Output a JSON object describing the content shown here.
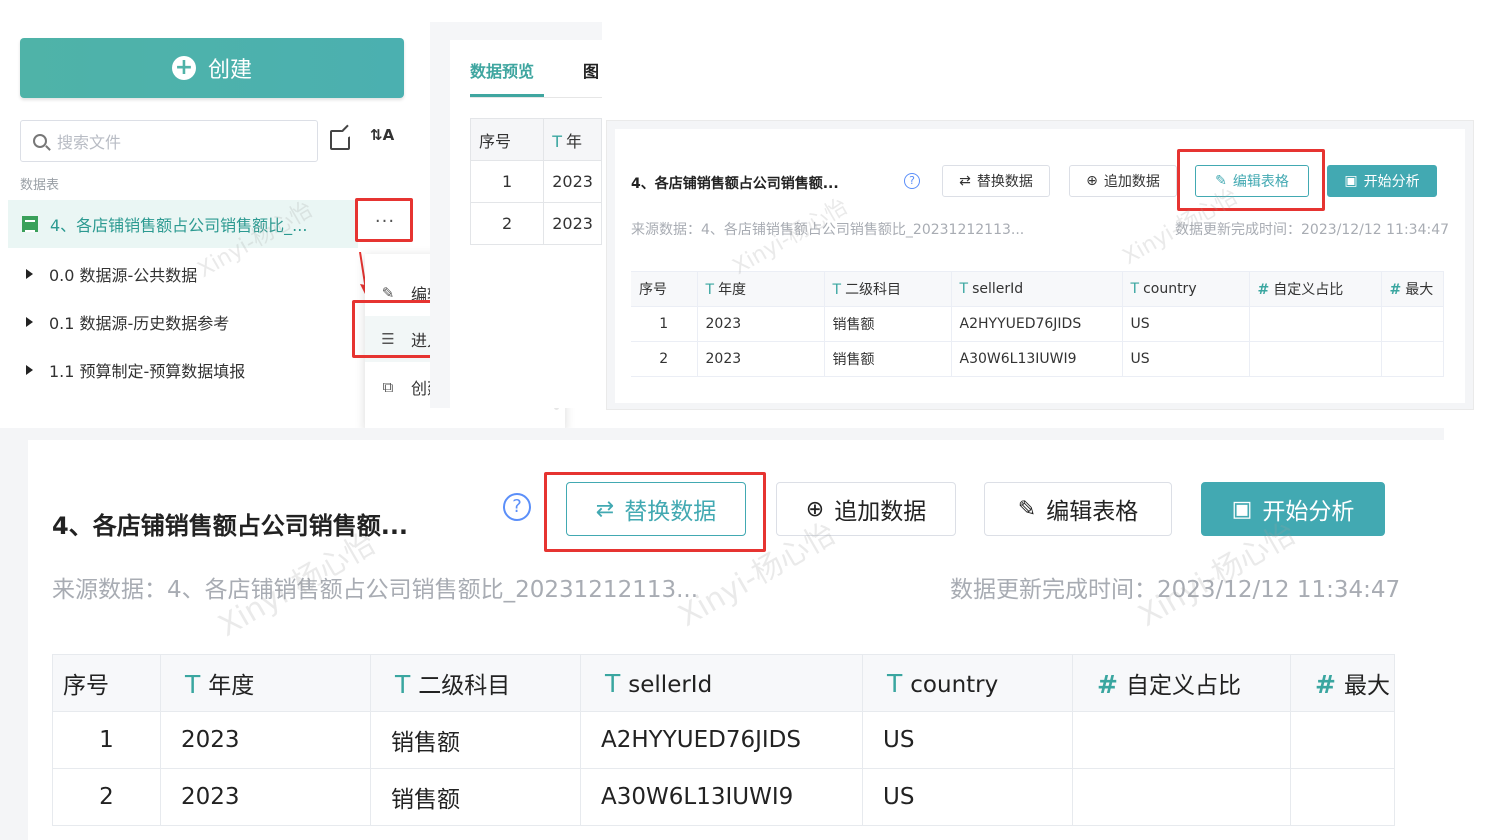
{
  "sidebar": {
    "create_label": "创建",
    "search_placeholder": "搜索文件",
    "section_label": "数据表",
    "active_file": "4、各店铺销售额占公司销售额比_...",
    "more_label": "···",
    "tree": [
      "0.0 数据源-公共数据",
      "0.1 数据源-历史数据参考",
      "1.1 预算制定-预算数据填报"
    ],
    "context_menu": [
      {
        "label": "编辑",
        "icon": "pencil-icon"
      },
      {
        "label": "进入数据源",
        "icon": "datasource-icon"
      },
      {
        "label": "创建副本",
        "icon": "copy-icon"
      }
    ]
  },
  "tabs_peek": {
    "tab_preview": "数据预览",
    "tab_chart": "图",
    "col_index": "序号",
    "col_year": "年",
    "rows": [
      {
        "idx": "1",
        "year": "2023"
      },
      {
        "idx": "2",
        "year": "2023"
      }
    ]
  },
  "dataset": {
    "title": "4、各店铺销售额占公司销售额...",
    "help": "?",
    "buttons": {
      "replace": "替换数据",
      "append": "追加数据",
      "edit": "编辑表格",
      "analyze": "开始分析"
    },
    "source_label": "来源数据：4、各店铺销售额占公司销售额比_20231212113...",
    "update_label": "数据更新完成时间：2023/12/12 11:34:47",
    "columns": [
      {
        "name": "序号",
        "type": ""
      },
      {
        "name": "年度",
        "type": "T"
      },
      {
        "name": "二级科目",
        "type": "T"
      },
      {
        "name": "sellerId",
        "type": "T"
      },
      {
        "name": "country",
        "type": "T"
      },
      {
        "name": "自定义占比",
        "type": "#"
      },
      {
        "name": "最大",
        "type": "#"
      }
    ],
    "rows": [
      {
        "idx": "1",
        "year": "2023",
        "subject": "销售额",
        "seller": "A2HYYUED76JIDS",
        "country": "US",
        "ratio": "",
        "max": ""
      },
      {
        "idx": "2",
        "year": "2023",
        "subject": "销售额",
        "seller": "A30W6L13IUWI9",
        "country": "US",
        "ratio": "",
        "max": ""
      }
    ]
  },
  "colors": {
    "teal": "#42a9b2",
    "highlight_red": "#e63431",
    "help_blue": "#5b8ff9"
  }
}
